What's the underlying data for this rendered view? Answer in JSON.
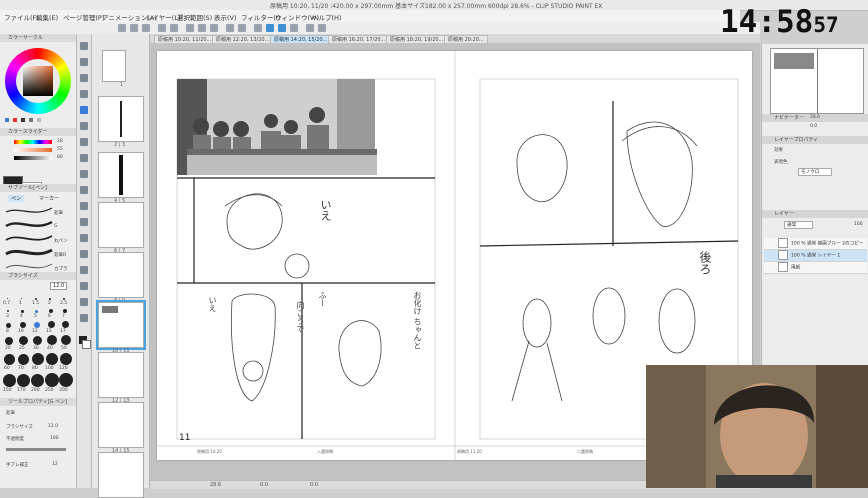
{
  "window": {
    "title": "原稿用 10:20, 11/20 :420.00 x 297.00mm 基本サイズ182.00 x 257.00mm 600dpi 28.6% - CLIP STUDIO PAINT EX"
  },
  "menu": [
    "ファイル(F)",
    "編集(E)",
    "ページ管理(P)",
    "アニメーション(A)",
    "レイヤー(L)",
    "選択範囲(S)",
    "表示(V)",
    "フィルター(I)",
    "ウィンドウ(W)",
    "ヘルプ(H)"
  ],
  "tabs": [
    {
      "label": "原稿用 10:20, 11/20..."
    },
    {
      "label": "原稿用 12:20, 13/20..."
    },
    {
      "label": "原稿用 14:20, 15/20..."
    },
    {
      "label": "原稿用 16:20, 17/20..."
    },
    {
      "label": "原稿用 18:20, 19/20..."
    },
    {
      "label": "原稿用 20:20..."
    }
  ],
  "left_panel": {
    "color_header": "カラーサークル",
    "slider_header": "カラースライダー",
    "subtool_header": "サブツール[ペン]",
    "subtool_tabs": [
      "ペン",
      "マーカー"
    ],
    "brushes": [
      "鉛筆",
      "G",
      "丸ペン",
      "鉛筆R",
      "カブラ"
    ],
    "brushsize_header": "ブラシサイズ",
    "brush_sizes": [
      "0.7",
      "1",
      "1.5",
      "2",
      "2.5",
      "3",
      "4",
      "5",
      "6",
      "7",
      "8",
      "10",
      "12",
      "15",
      "17",
      "20",
      "25",
      "30",
      "40",
      "50",
      "60",
      "70",
      "80",
      "100",
      "120",
      "150",
      "170",
      "200",
      "250",
      "300"
    ],
    "current_size": "12.0",
    "tool_property_header": "ツールプロパティ[G ペン]",
    "tool_property_sub": "鉛筆",
    "props": [
      {
        "label": "ブラシサイズ",
        "value": "12.0"
      },
      {
        "label": "不透明度",
        "value": "100"
      },
      {
        "label": "手ブレ補正",
        "value": "12"
      }
    ],
    "rgb_values": [
      "28",
      "55",
      "80"
    ]
  },
  "page_list": {
    "pages": [
      {
        "num": "1"
      },
      {
        "num": "2 | 3"
      },
      {
        "num": "4 | 5"
      },
      {
        "num": "6 | 7"
      },
      {
        "num": "8 | 9"
      },
      {
        "num": "10 | 11"
      },
      {
        "num": "12 | 13"
      },
      {
        "num": "14 | 15"
      },
      {
        "num": ""
      }
    ],
    "selected_index": 5
  },
  "canvas": {
    "page_number": "11",
    "footer_left": "原稿用 10:20",
    "footer_left2": "入選原稿",
    "footer_right": "原稿用 11:20",
    "footer_right2": "二選原稿",
    "dialogue": [
      "いえ",
      "いえ",
      "お化け ちゃんと",
      "ふー",
      "向こうで",
      "後ろ"
    ]
  },
  "right_panel": {
    "navigator_header": "ナビゲーター",
    "zoom": "28.6",
    "angle": "0.0",
    "layer_property_header": "レイヤープロパティ",
    "effect_label": "効果",
    "expression_label": "表現色",
    "expression_value": "モノクロ",
    "layers_header": "レイヤー",
    "blend_mode": "通常",
    "opacity": "100",
    "layers": [
      {
        "name": "100 % 通常 線画ブルー 2のコピー",
        "selected": false
      },
      {
        "name": "100 % 通常 レイヤー 1",
        "selected": true
      },
      {
        "name": "用紙",
        "selected": false
      }
    ]
  },
  "clock": {
    "time": "14:58",
    "seconds": "57"
  },
  "status": {
    "zoom": "28.6",
    "angle": "0.0",
    "coords": "0.0"
  }
}
